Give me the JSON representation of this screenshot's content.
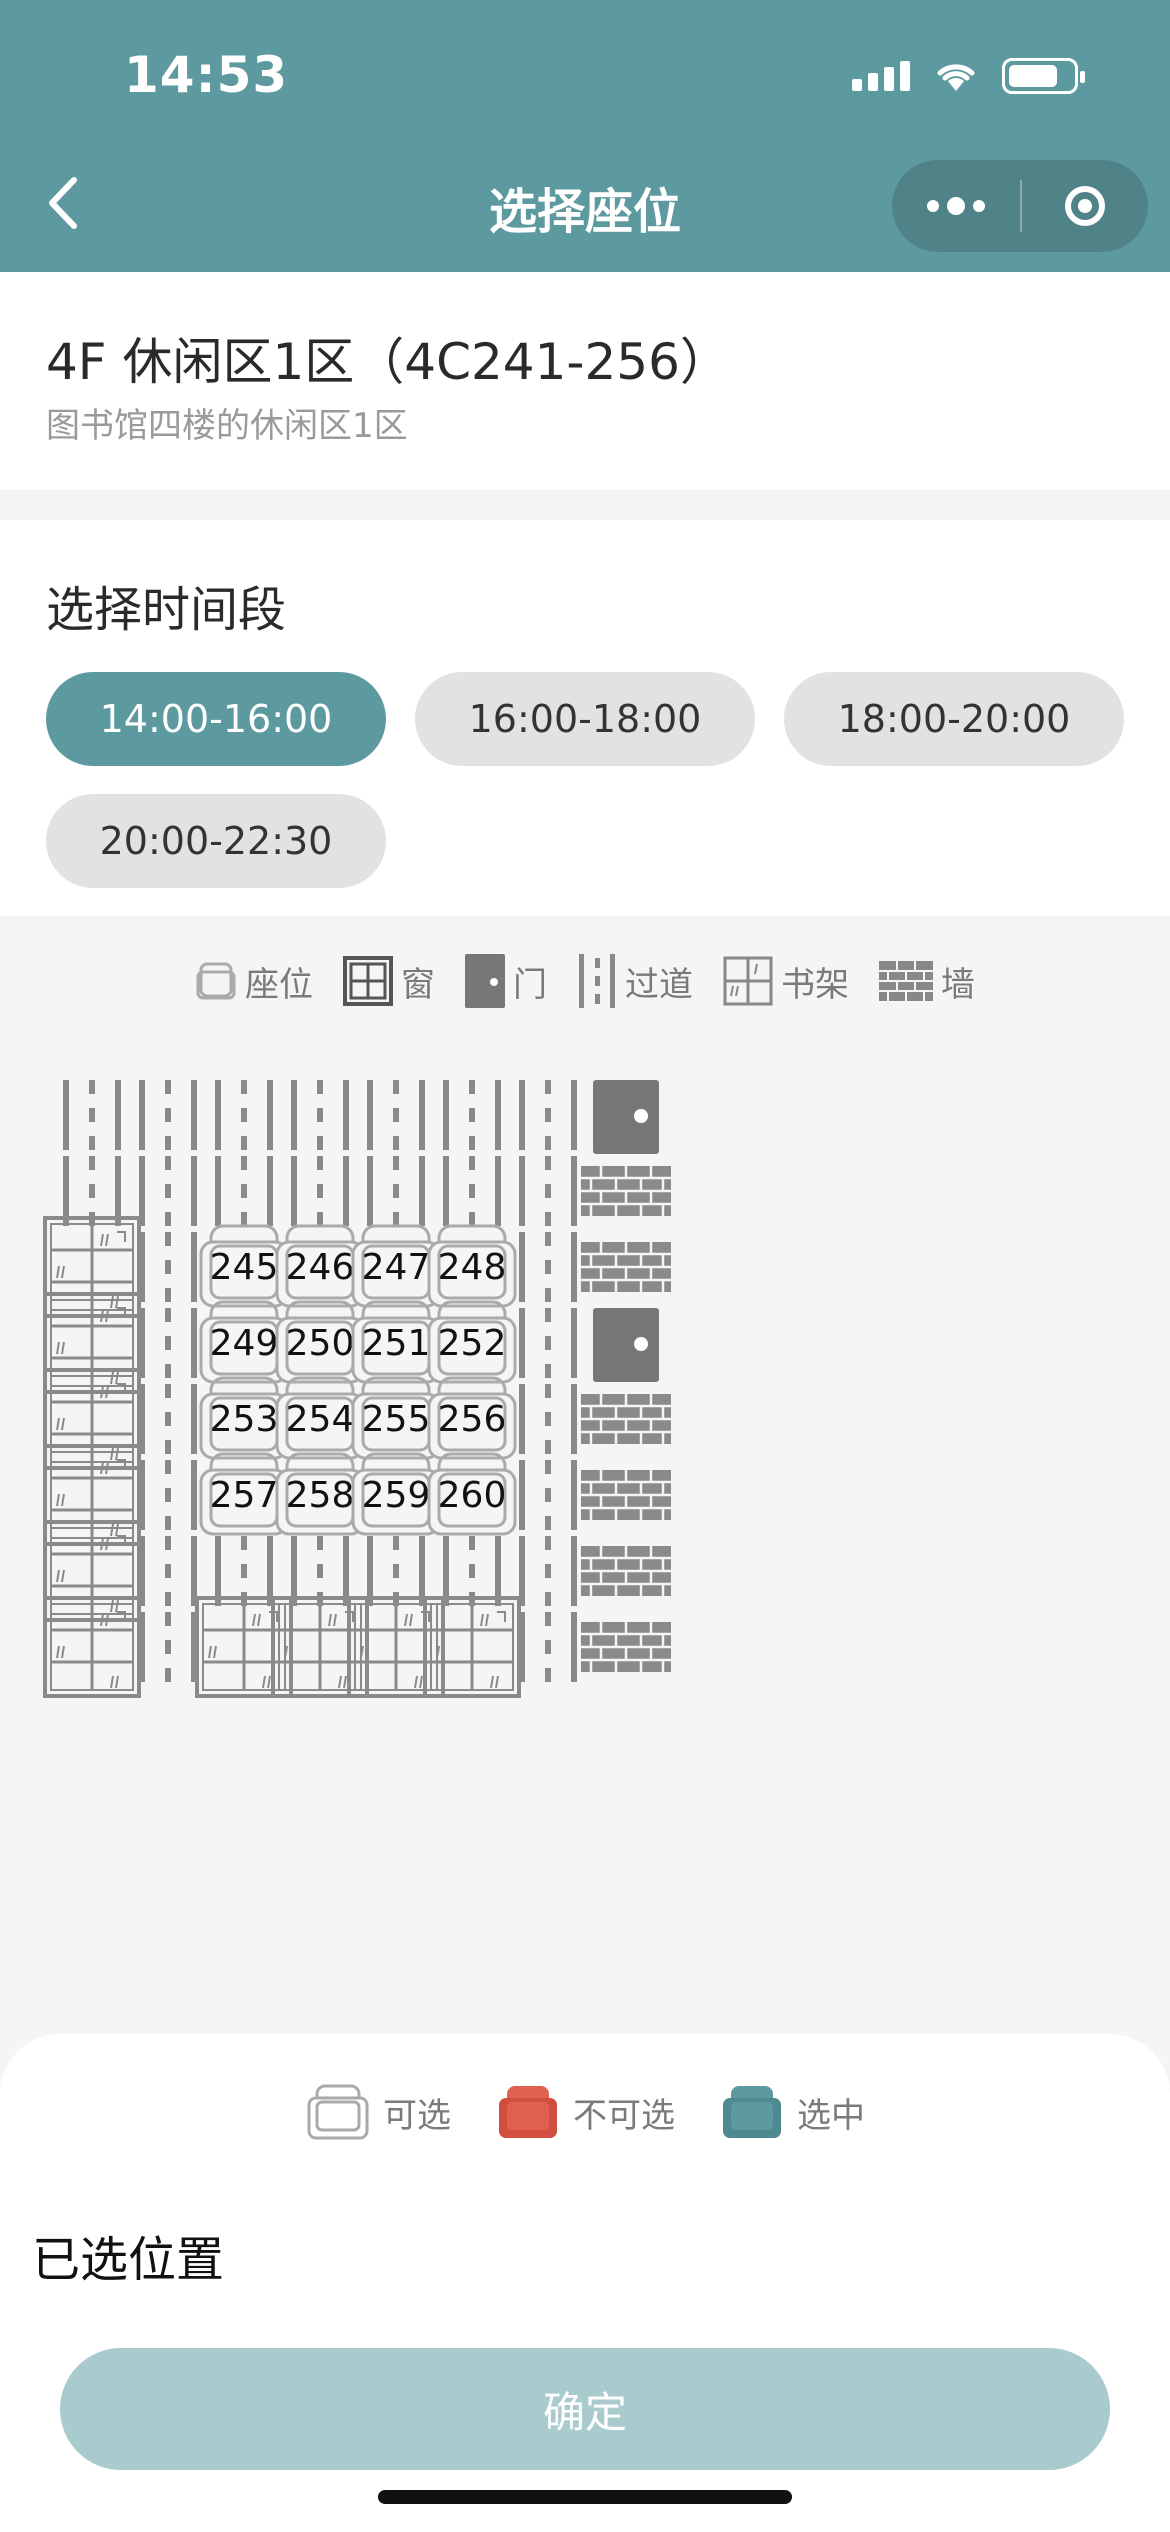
{
  "status": {
    "time": "14:53"
  },
  "nav": {
    "title": "选择座位"
  },
  "area": {
    "title": "4F 休闲区1区（4C241-256）",
    "subtitle": "图书馆四楼的休闲区1区"
  },
  "time": {
    "title": "选择时间段",
    "slots": [
      "14:00-16:00",
      "16:00-18:00",
      "18:00-20:00",
      "20:00-22:30"
    ],
    "active_index": 0
  },
  "legend": {
    "seat": "座位",
    "window": "窗",
    "door": "门",
    "aisle": "过道",
    "shelf": "书架",
    "wall": "墙"
  },
  "grid": {
    "rows": [
      [
        "aisle",
        "aisle",
        "aisle",
        "aisle",
        "aisle",
        "aisle",
        "aisle",
        "door"
      ],
      [
        "aisle",
        "aisle",
        "aisle",
        "aisle",
        "aisle",
        "aisle",
        "aisle",
        "wall"
      ],
      [
        "shelf",
        "aisle",
        "seat:245",
        "seat:246",
        "seat:247",
        "seat:248",
        "aisle",
        "wall"
      ],
      [
        "shelf",
        "aisle",
        "seat:249",
        "seat:250",
        "seat:251",
        "seat:252",
        "aisle",
        "door"
      ],
      [
        "shelf",
        "aisle",
        "seat:253",
        "seat:254",
        "seat:255",
        "seat:256",
        "aisle",
        "wall"
      ],
      [
        "shelf",
        "aisle",
        "seat:257",
        "seat:258",
        "seat:259",
        "seat:260",
        "aisle",
        "wall"
      ],
      [
        "shelf",
        "aisle",
        "aisle",
        "aisle",
        "aisle",
        "aisle",
        "aisle",
        "wall"
      ],
      [
        "shelf",
        "aisle",
        "shelf",
        "shelf",
        "shelf",
        "shelf",
        "aisle",
        "wall"
      ]
    ]
  },
  "states": {
    "available": "可选",
    "unavailable": "不可选",
    "selected": "选中"
  },
  "colors": {
    "primary": "#5d9aa0",
    "unavailable": "#e06052",
    "disabled_button": "#a9cbce",
    "icon_gray": "#8a8a8a"
  },
  "selection": {
    "label": "已选位置"
  },
  "confirm": {
    "label": "确定"
  }
}
